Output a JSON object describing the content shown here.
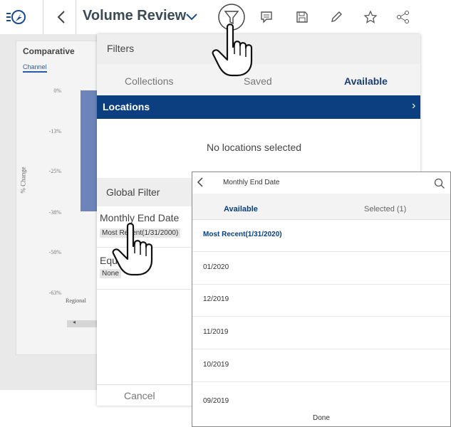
{
  "toolbar": {
    "title": "Volume Review",
    "icons": [
      "menu-logo-icon",
      "back-icon",
      "dropdown-chevron-icon",
      "filter-icon",
      "comment-icon",
      "save-icon",
      "edit-icon",
      "favorite-icon",
      "share-icon"
    ]
  },
  "dashboard": {
    "card_title": "Comparative",
    "tab": "Channel",
    "y_axis_label": "% Change",
    "y_ticks": [
      "0%",
      "-13%",
      "-25%",
      "-38%",
      "-50%",
      "-63%"
    ],
    "x_category": "Regional",
    "bar_color": "#6c84ba"
  },
  "filters": {
    "title": "Filters",
    "tabs": [
      "Collections",
      "Saved",
      "Available"
    ],
    "active_tab": "Available",
    "locations_label": "Locations",
    "no_locations_text": "No locations selected",
    "global_filter_label": "Global Filter",
    "monthly_end_date": {
      "label": "Monthly End Date",
      "value": "Most Recent(1/31/2000)"
    },
    "equ": {
      "label": "Equ",
      "value": "None"
    },
    "cancel_label": "Cancel",
    "accent": "#0b3f7f"
  },
  "picker": {
    "title": "Monthly End Date",
    "tab_available": "Available",
    "tab_selected": "Selected (1)",
    "items": [
      "Most Recent(1/31/2020)",
      "01/2020",
      "12/2019",
      "11/2019",
      "10/2019",
      "09/2019"
    ],
    "done_label": "Done"
  }
}
